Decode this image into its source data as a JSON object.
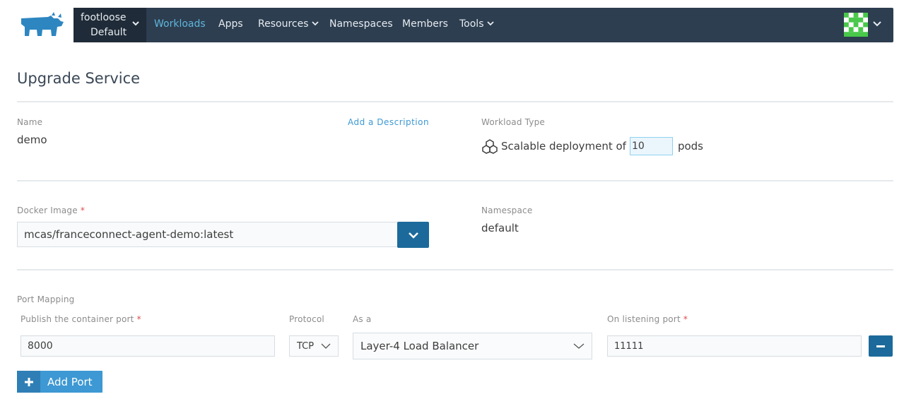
{
  "header": {
    "logo_icon": "rancher-cow-logo-icon",
    "context": {
      "cluster": "footloose",
      "project": "Default"
    },
    "nav": [
      {
        "label": "Workloads",
        "active": true,
        "dropdown": false
      },
      {
        "label": "Apps",
        "active": false,
        "dropdown": false
      },
      {
        "label": "Resources",
        "active": false,
        "dropdown": true
      },
      {
        "label": "Namespaces",
        "active": false,
        "dropdown": false
      },
      {
        "label": "Members",
        "active": false,
        "dropdown": false
      },
      {
        "label": "Tools",
        "active": false,
        "dropdown": true
      }
    ],
    "avatar_icon": "user-avatar-icon"
  },
  "page": {
    "title": "Upgrade Service"
  },
  "form": {
    "name": {
      "label": "Name",
      "value": "demo"
    },
    "description_link": "Add a Description",
    "workload_type": {
      "label": "Workload Type",
      "prefix": "Scalable deployment of",
      "scale": "10",
      "suffix": "pods",
      "icon": "scalable-deployment-icon"
    },
    "docker_image": {
      "label": "Docker Image",
      "required": "*",
      "value": "mcas/franceconnect-agent-demo:latest"
    },
    "namespace": {
      "label": "Namespace",
      "value": "default"
    },
    "port_mapping": {
      "label": "Port Mapping",
      "columns": {
        "container_port": "Publish the container port",
        "protocol": "Protocol",
        "as_a": "As a",
        "listening_port": "On listening port"
      },
      "required": "*",
      "row": {
        "container_port": "8000",
        "protocol": "TCP",
        "as_a": "Layer-4 Load Balancer",
        "listening_port": "11111"
      },
      "add_label": "Add Port"
    }
  },
  "colors": {
    "nav_bg": "#2d3e50",
    "context_bg": "#1f2b38",
    "nav_active": "#5fb6dc",
    "primary_btn": "#1c6a9b",
    "add_btn": "#3d98d3",
    "required": "#e14b4b"
  }
}
